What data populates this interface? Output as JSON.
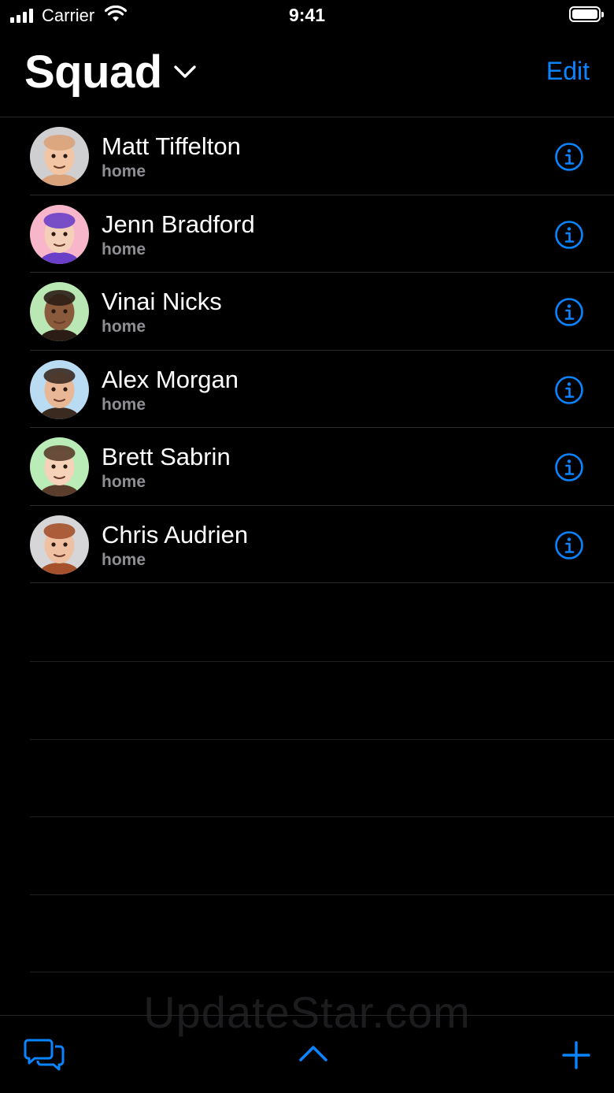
{
  "status_bar": {
    "carrier": "Carrier",
    "time": "9:41"
  },
  "header": {
    "title": "Squad",
    "edit_label": "Edit"
  },
  "contacts": [
    {
      "name": "Matt Tiffelton",
      "label": "home",
      "avatar_bg": "#cfcfd1",
      "skin": "#f2c6a5",
      "hair": "#d9a27a"
    },
    {
      "name": "Jenn Bradford",
      "label": "home",
      "avatar_bg": "#f7b6c9",
      "skin": "#f4d0b8",
      "hair": "#6a3fc8"
    },
    {
      "name": "Vinai Nicks",
      "label": "home",
      "avatar_bg": "#b9e8b4",
      "skin": "#8a5a3c",
      "hair": "#2b1d15"
    },
    {
      "name": "Alex Morgan",
      "label": "home",
      "avatar_bg": "#b9dcf3",
      "skin": "#e8b796",
      "hair": "#3b2a20"
    },
    {
      "name": "Brett Sabrin",
      "label": "home",
      "avatar_bg": "#b9ecb6",
      "skin": "#f6d2b8",
      "hair": "#5a3d2b"
    },
    {
      "name": "Chris Audrien",
      "label": "home",
      "avatar_bg": "#d6d6d8",
      "skin": "#f0c0a2",
      "hair": "#a4512c"
    }
  ],
  "watermark": "UpdateStar.com",
  "colors": {
    "accent": "#0a84ff",
    "background": "#000000",
    "secondary_text": "#8e8e93"
  },
  "icons": {
    "title_chevron": "chevron-down-icon",
    "info": "info-circle-icon",
    "messages": "messages-icon",
    "expand": "chevron-up-icon",
    "add": "plus-icon"
  }
}
